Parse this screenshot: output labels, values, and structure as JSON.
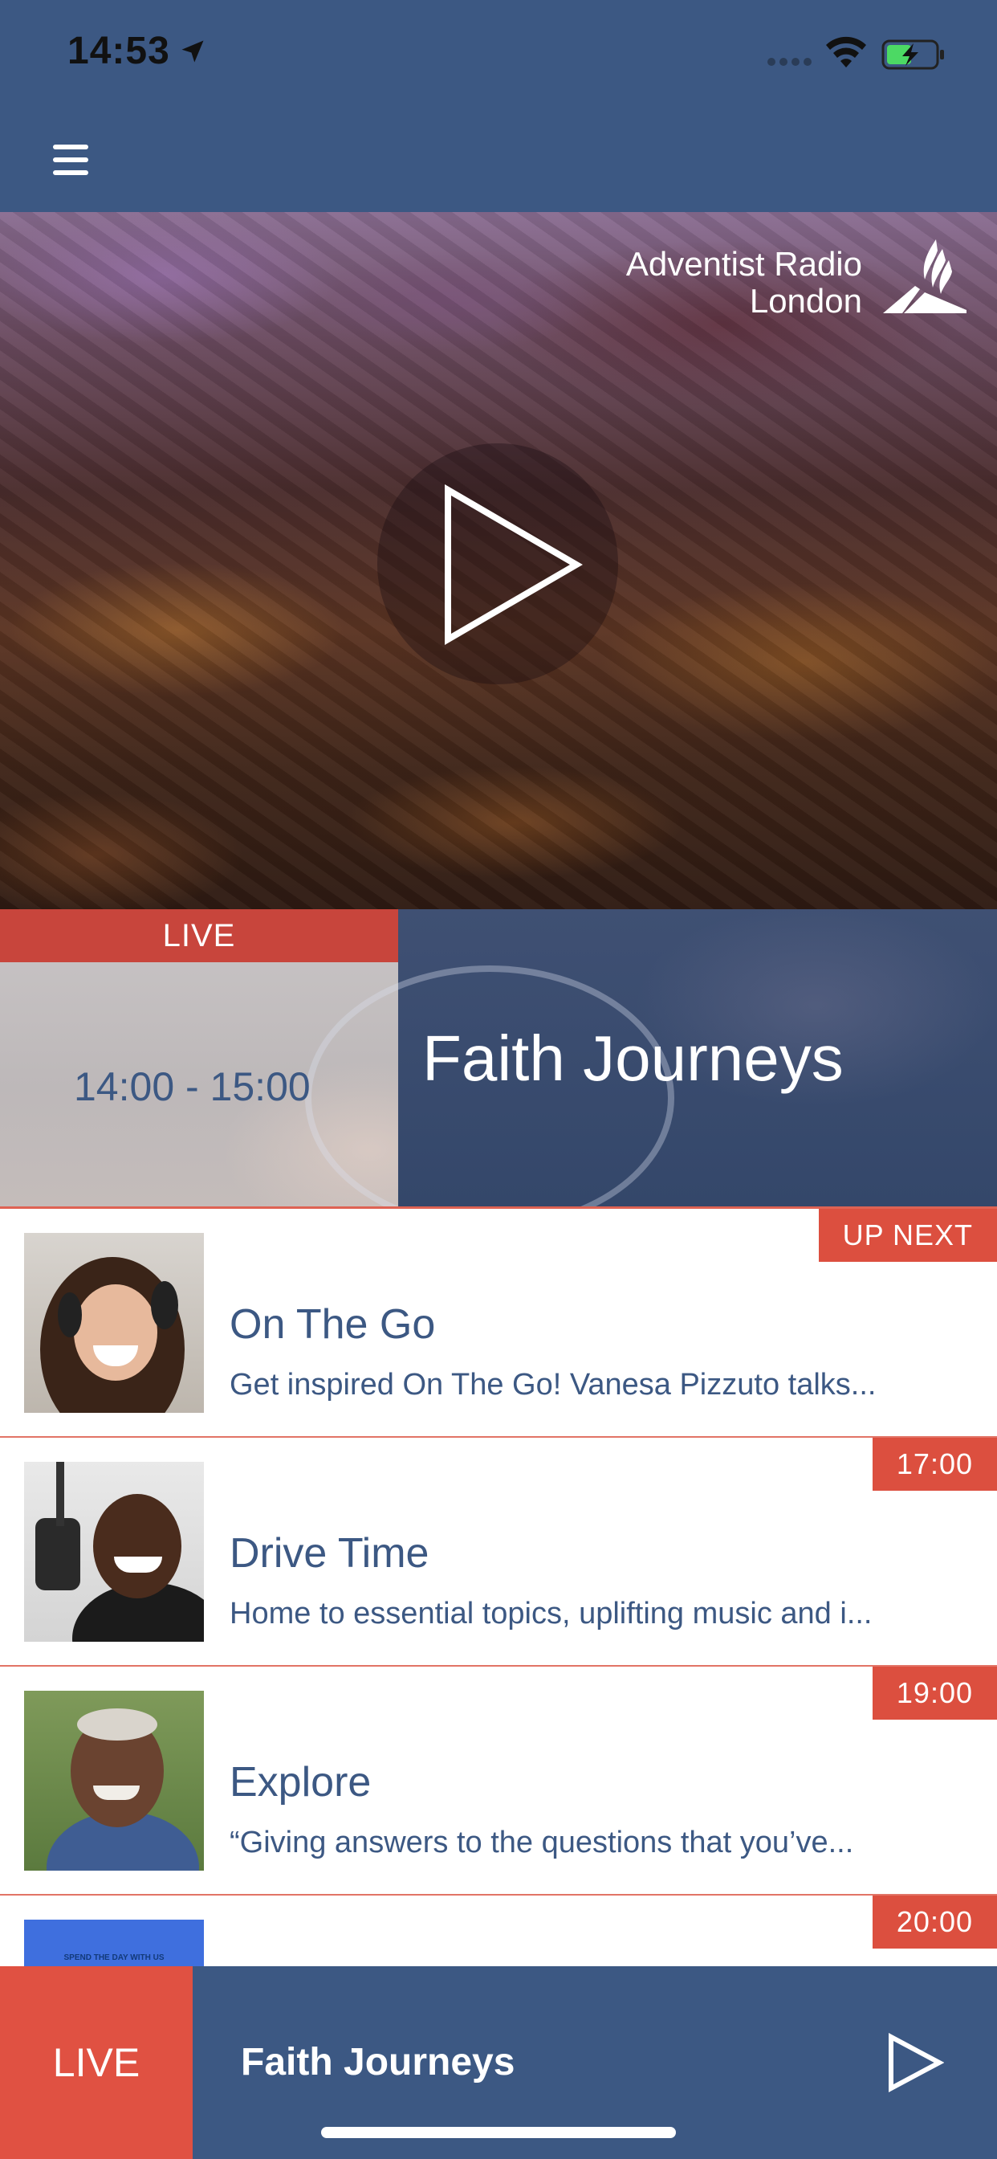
{
  "status_bar": {
    "time": "14:53",
    "icons": [
      "location-arrow-icon",
      "signal-icon",
      "wifi-icon",
      "battery-charging-icon"
    ]
  },
  "nav": {
    "menu_icon": "hamburger-menu-icon"
  },
  "hero": {
    "brand_line1": "Adventist Radio",
    "brand_line2": "London",
    "logo_icon": "adventist-flame-logo",
    "play_icon": "play-icon"
  },
  "now_playing": {
    "live_label": "LIVE",
    "time": "14:00 - 15:00",
    "title": "Faith Journeys"
  },
  "schedule": [
    {
      "badge": "UP NEXT",
      "title": "On The Go",
      "description": "Get inspired On The Go! Vanesa Pizzuto talks..."
    },
    {
      "badge": "17:00",
      "title": "Drive Time",
      "description": "Home to essential topics, uplifting music and i..."
    },
    {
      "badge": "19:00",
      "title": "Explore",
      "description": "“Giving answers to the questions that you’ve..."
    },
    {
      "badge": "20:00",
      "thumb_text": "SPEND THE DAY WITH US"
    }
  ],
  "player": {
    "live_label": "LIVE",
    "title": "Faith Journeys",
    "play_icon": "play-icon"
  },
  "colors": {
    "nav_blue": "#3c5883",
    "accent_red": "#dc4f3f",
    "white": "#ffffff"
  }
}
